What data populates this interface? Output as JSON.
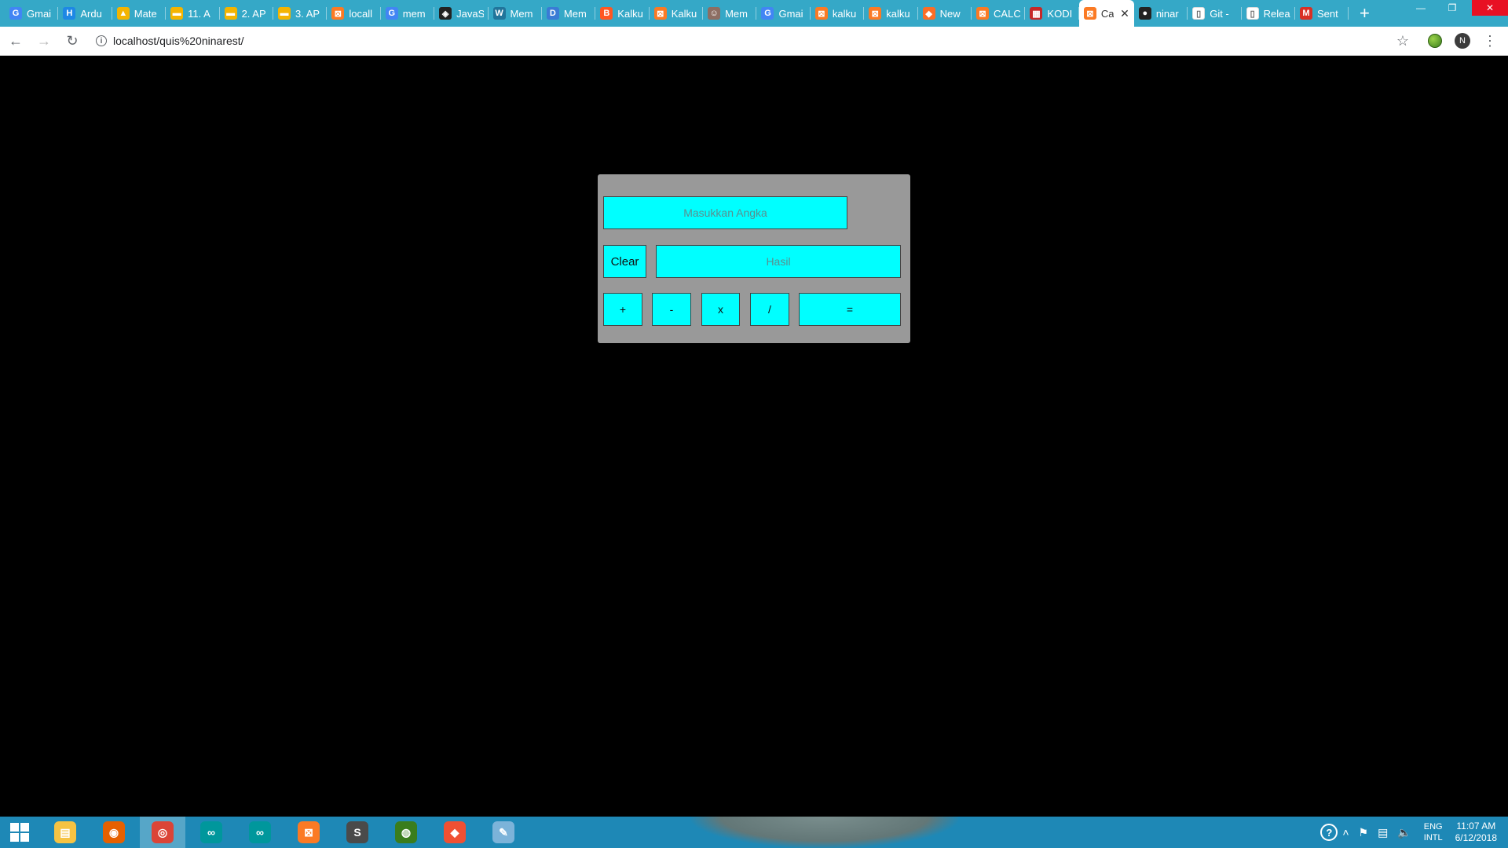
{
  "browser": {
    "tabs": [
      {
        "title": "Gmai",
        "favicon": "google-icon",
        "color": "#4285f4",
        "glyph": "G"
      },
      {
        "title": "Ardu",
        "favicon": "hackster-icon",
        "color": "#1e88e5",
        "glyph": "H"
      },
      {
        "title": "Mate",
        "favicon": "google-drive-icon",
        "color": "#f4b400",
        "glyph": "▲"
      },
      {
        "title": "11. A",
        "favicon": "slides-icon",
        "color": "#f4b400",
        "glyph": "▬"
      },
      {
        "title": "2. AP",
        "favicon": "slides-icon",
        "color": "#f4b400",
        "glyph": "▬"
      },
      {
        "title": "3. AP",
        "favicon": "slides-icon",
        "color": "#f4b400",
        "glyph": "▬"
      },
      {
        "title": "locall",
        "favicon": "xampp-icon",
        "color": "#fb7a24",
        "glyph": "⊠"
      },
      {
        "title": "mem",
        "favicon": "google-icon",
        "color": "#4285f4",
        "glyph": "G"
      },
      {
        "title": "JavaS",
        "favicon": "codepen-icon",
        "color": "#222222",
        "glyph": "◈"
      },
      {
        "title": "Mem",
        "favicon": "wordpress-icon",
        "color": "#21759b",
        "glyph": "W"
      },
      {
        "title": "Mem",
        "favicon": "d-icon",
        "color": "#3a7bd5",
        "glyph": "D"
      },
      {
        "title": "Kalku",
        "favicon": "blogger-icon",
        "color": "#ff5722",
        "glyph": "B"
      },
      {
        "title": "Kalku",
        "favicon": "xampp-icon",
        "color": "#fb7a24",
        "glyph": "⊠"
      },
      {
        "title": "Mem",
        "favicon": "person-icon",
        "color": "#8d6e63",
        "glyph": "☺"
      },
      {
        "title": "Gmai",
        "favicon": "google-icon",
        "color": "#4285f4",
        "glyph": "G"
      },
      {
        "title": "kalku",
        "favicon": "xampp-icon",
        "color": "#fb7a24",
        "glyph": "⊠"
      },
      {
        "title": "kalku",
        "favicon": "xampp-icon",
        "color": "#fb7a24",
        "glyph": "⊠"
      },
      {
        "title": "New",
        "favicon": "gitlab-icon",
        "color": "#fc6d26",
        "glyph": "◆"
      },
      {
        "title": "CALC",
        "favicon": "xampp-icon",
        "color": "#fb7a24",
        "glyph": "⊠"
      },
      {
        "title": "KODI",
        "favicon": "kodi-icon",
        "color": "#c62828",
        "glyph": "▦"
      },
      {
        "title": "Ca",
        "favicon": "xampp-icon",
        "color": "#fb7a24",
        "glyph": "⊠",
        "active": true
      },
      {
        "title": "ninar",
        "favicon": "github-icon",
        "color": "#222222",
        "glyph": "●"
      },
      {
        "title": "Git -",
        "favicon": "page-icon",
        "color": "#ffffff",
        "glyph": "▯"
      },
      {
        "title": "Relea",
        "favicon": "page-icon",
        "color": "#ffffff",
        "glyph": "▯"
      },
      {
        "title": "Sent",
        "favicon": "gmail-icon",
        "color": "#d93025",
        "glyph": "M"
      }
    ],
    "new_tab": "+",
    "url": "localhost/quis%20ninarest/",
    "profile_initial": "N"
  },
  "calculator": {
    "input_placeholder": "Masukkan Angka",
    "clear_label": "Clear",
    "result_placeholder": "Hasil",
    "ops": {
      "plus": "+",
      "minus": "-",
      "times": "x",
      "divide": "/",
      "equals": "="
    }
  },
  "taskbar": {
    "apps": [
      {
        "name": "file-explorer-icon",
        "color": "#f6c343",
        "glyph": "▤"
      },
      {
        "name": "firefox-icon",
        "color": "#e66000",
        "glyph": "◉"
      },
      {
        "name": "chrome-icon",
        "color": "#db4437",
        "glyph": "◎",
        "active": true
      },
      {
        "name": "arduino-icon",
        "color": "#00979c",
        "glyph": "∞"
      },
      {
        "name": "arduino-icon-2",
        "color": "#00979c",
        "glyph": "∞"
      },
      {
        "name": "xampp-icon",
        "color": "#fb7a24",
        "glyph": "⊠"
      },
      {
        "name": "sublime-text-icon",
        "color": "#4a4a4a",
        "glyph": "S"
      },
      {
        "name": "globe-app-icon",
        "color": "#3a7d1d",
        "glyph": "◍"
      },
      {
        "name": "git-app-icon",
        "color": "#f05033",
        "glyph": "◆"
      },
      {
        "name": "paint-icon",
        "color": "#7cb3d9",
        "glyph": "✎"
      }
    ],
    "lang_line1": "ENG",
    "lang_line2": "INTL",
    "time": "11:07 AM",
    "date": "6/12/2018"
  }
}
